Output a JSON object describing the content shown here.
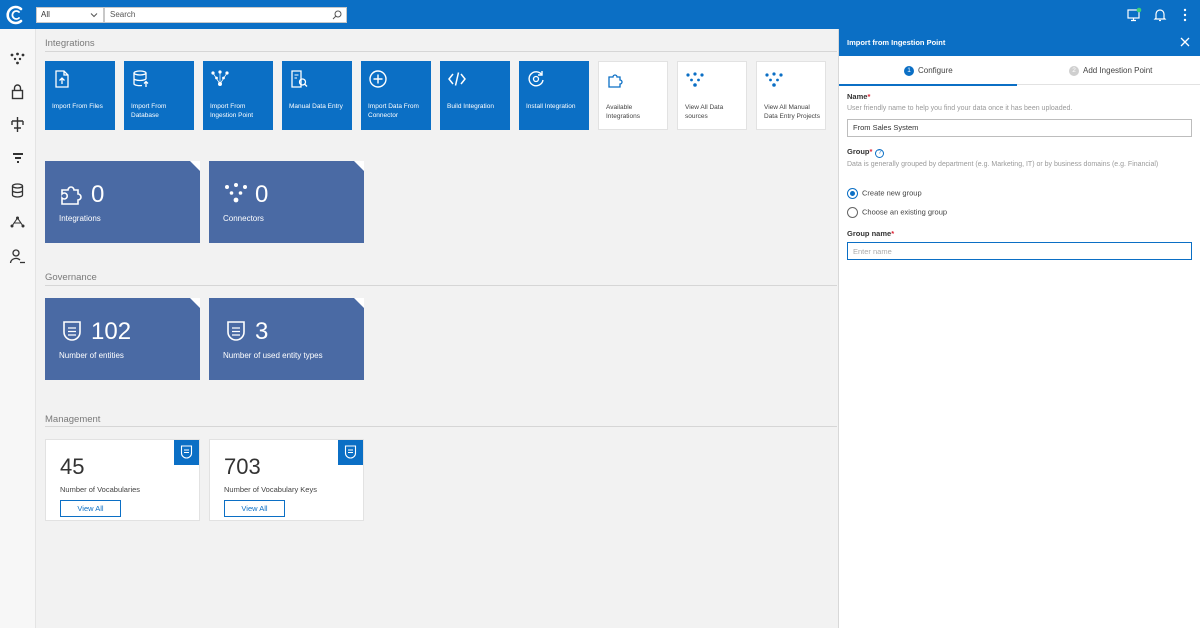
{
  "colors": {
    "brand": "#0b6fc5",
    "stat_tile": "#4a6aa4",
    "background": "#f2f2f2"
  },
  "topbar": {
    "scope_value": "All",
    "search_placeholder": "Search",
    "icons": [
      "logo-icon",
      "chevron-down-icon",
      "search-icon",
      "monitor-icon",
      "bell-icon",
      "more-vertical-icon"
    ]
  },
  "leftnav": {
    "icons": [
      "integrations-icon",
      "lock-icon",
      "hierarchy-icon",
      "filter-icon",
      "database-icon",
      "network-icon",
      "user-settings-icon"
    ]
  },
  "main": {
    "integrations_title": "Integrations",
    "tiles": [
      {
        "label": "Import From Files",
        "icon": "file-upload-icon"
      },
      {
        "label": "Import From Database",
        "icon": "database-upload-icon"
      },
      {
        "label": "Import From Ingestion Point",
        "icon": "ingestion-point-icon"
      },
      {
        "label": "Manual Data Entry",
        "icon": "manual-entry-icon"
      },
      {
        "label": "Import Data From Connector",
        "icon": "plus-circle-icon"
      },
      {
        "label": "Build Integration",
        "icon": "code-icon"
      },
      {
        "label": "Install Integration",
        "icon": "install-icon"
      },
      {
        "label": "Available Integrations",
        "icon": "puzzle-icon"
      },
      {
        "label": "View All Data sources",
        "icon": "data-sources-icon"
      },
      {
        "label": "View All Manual Data Entry Projects",
        "icon": "manual-projects-icon"
      }
    ],
    "integration_stats": [
      {
        "value": "0",
        "label": "Integrations",
        "icon": "puzzle-icon"
      },
      {
        "value": "0",
        "label": "Connectors",
        "icon": "connectors-icon"
      }
    ],
    "governance_title": "Governance",
    "governance_stats": [
      {
        "value": "102",
        "label": "Number of entities",
        "icon": "shield-icon"
      },
      {
        "value": "3",
        "label": "Number of used entity types",
        "icon": "shield-icon"
      }
    ],
    "management_title": "Management",
    "management_cards": [
      {
        "value": "45",
        "label": "Number of Vocabularies",
        "button": "View All",
        "icon": "shield-icon"
      },
      {
        "value": "703",
        "label": "Number of Vocabulary Keys",
        "button": "View All",
        "icon": "shield-icon"
      }
    ]
  },
  "panel": {
    "title": "Import from Ingestion Point",
    "steps": [
      {
        "num": "1",
        "label": "Configure",
        "active": true
      },
      {
        "num": "2",
        "label": "Add Ingestion Point",
        "active": false
      }
    ],
    "name_label": "Name",
    "required_mark": "*",
    "name_help": "User friendly name to help you find your data once it has been uploaded.",
    "name_value": "From Sales System",
    "group_label": "Group",
    "group_help_icon": "?",
    "group_help": "Data is generally grouped by department (e.g. Marketing, IT) or by business domains (e.g. Financial)",
    "radio_new": "Create new group",
    "radio_existing": "Choose an existing group",
    "group_name_label": "Group name",
    "group_name_placeholder": "Enter name"
  }
}
